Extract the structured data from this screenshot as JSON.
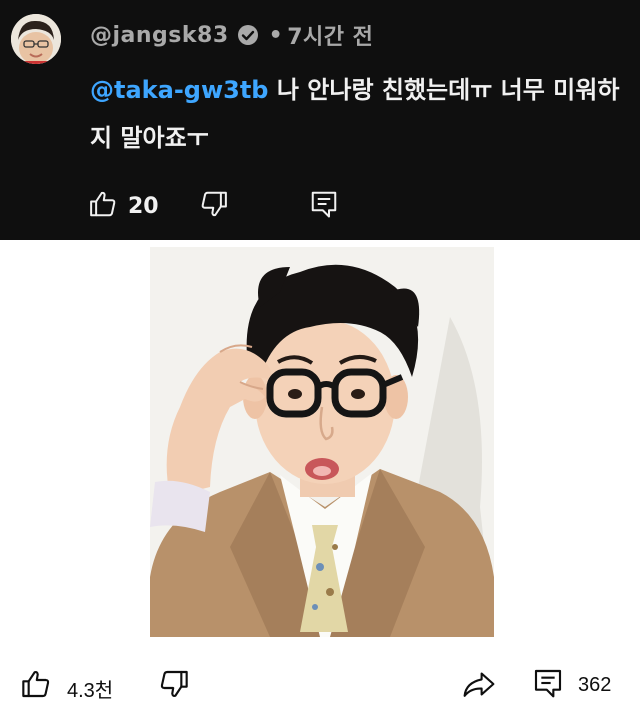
{
  "comment": {
    "author": "@jangsk83",
    "time": "7시간 전",
    "mention": "@taka-gw3tb",
    "text": " 나 안나랑 친했는데ㅠ 너무 미워하지 말아죠ㅜ",
    "like_count": "20"
  },
  "post": {
    "like_count": "4.3천",
    "comment_count": "362"
  },
  "colors": {
    "comment_bg": "#0f0f0f",
    "mention": "#3ea6ff",
    "text_light": "#f1f1f1",
    "meta_gray": "#a9a9a9"
  },
  "icons": {
    "comment_like": "thumbs-up-icon",
    "comment_dislike": "thumbs-down-icon",
    "comment_reply": "reply-icon",
    "post_like": "thumbs-up-icon",
    "post_dislike": "thumbs-down-icon",
    "post_share": "share-icon",
    "post_comments": "comment-icon"
  }
}
